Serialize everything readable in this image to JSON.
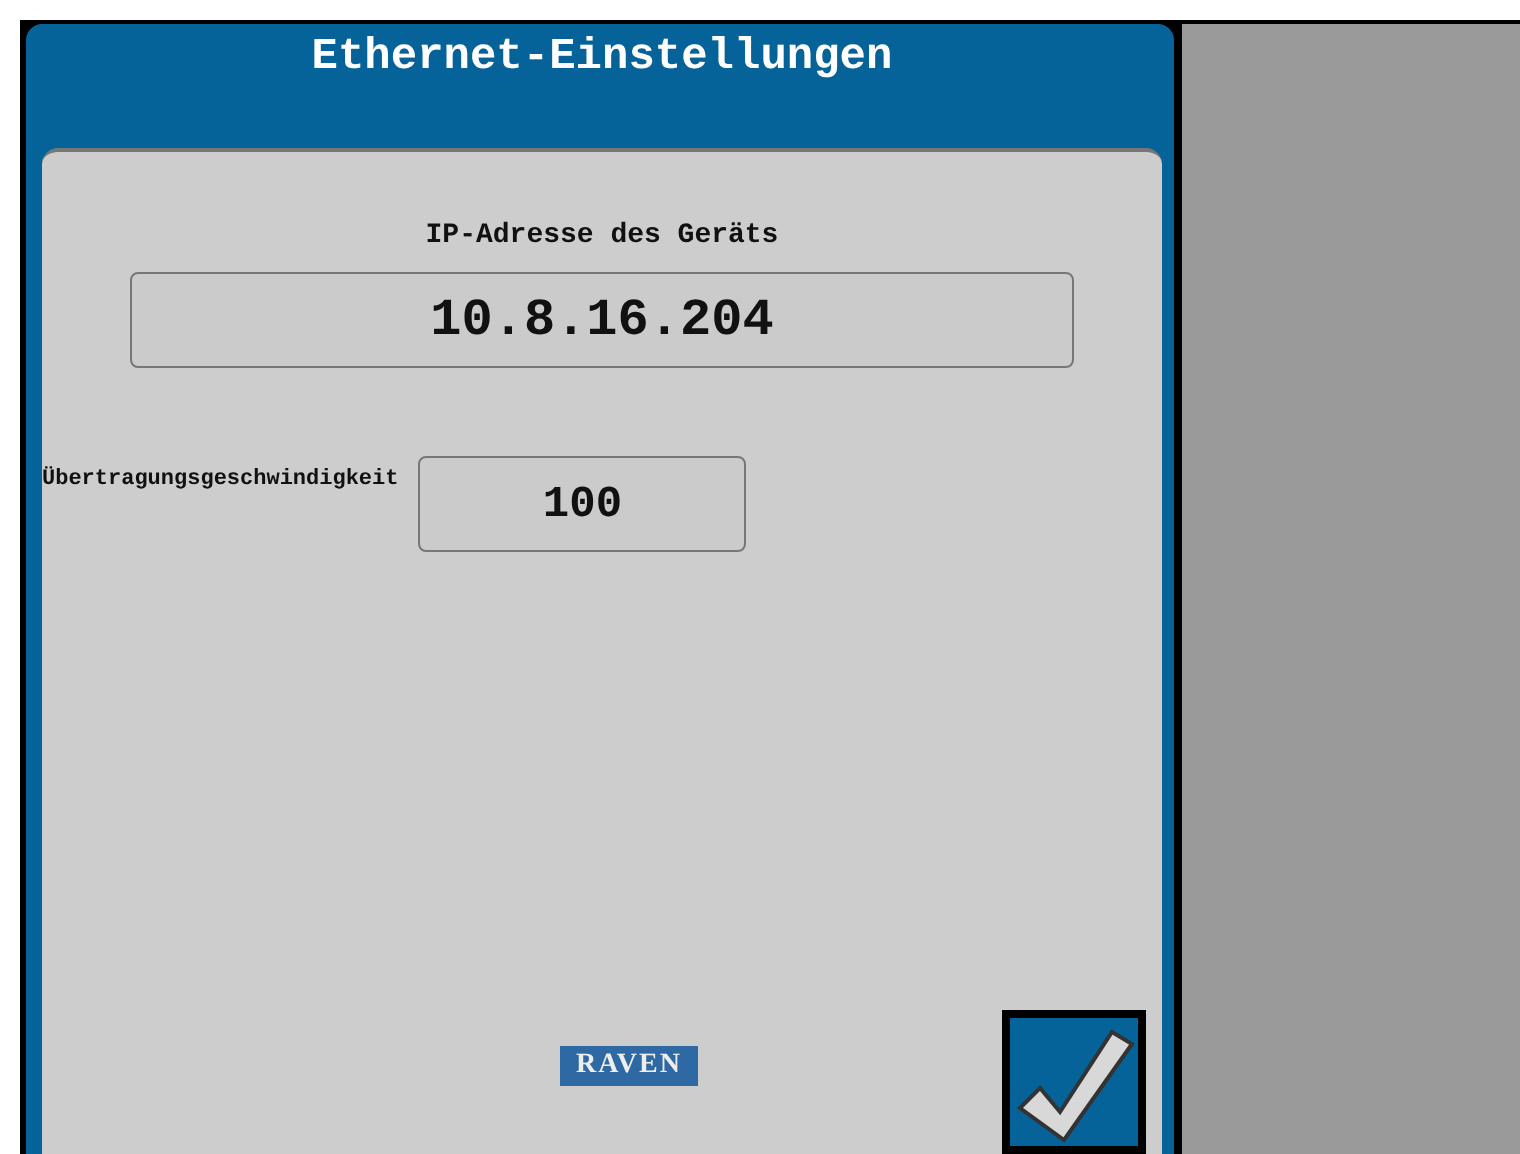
{
  "window": {
    "title": "Ethernet-Einstellungen"
  },
  "fields": [
    {
      "kind": "stacked",
      "label": "IP-Adresse des Geräts",
      "value": "10.8.16.204"
    },
    {
      "kind": "inline",
      "label": "Übertragungsgeschwindigkeit",
      "value": "100"
    }
  ],
  "logo": "RAVEN"
}
